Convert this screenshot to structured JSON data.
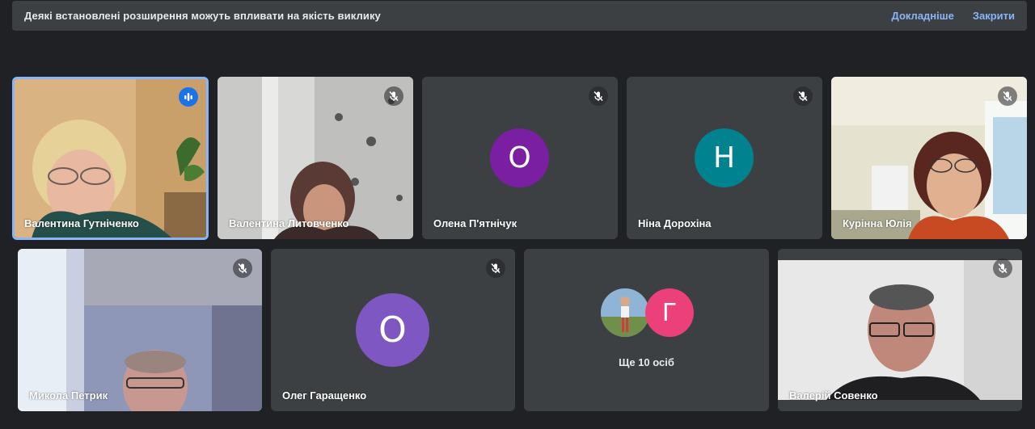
{
  "banner": {
    "message": "Деякі встановлені розширення можуть впливати на якість виклику",
    "details_link": "Докладніше",
    "close_link": "Закрити"
  },
  "participants": [
    {
      "name": "Валентина Гутніченко",
      "state": "speaking",
      "video": true
    },
    {
      "name": "Валентина Литовченко",
      "state": "muted",
      "video": true
    },
    {
      "name": "Олена П'ятнічук",
      "state": "muted",
      "video": false,
      "initial": "О",
      "avatar_color": "#7b1fa2"
    },
    {
      "name": "Ніна Дорохіна",
      "state": "muted",
      "video": false,
      "initial": "Н",
      "avatar_color": "#00838f"
    },
    {
      "name": "Курінна Юлія",
      "state": "muted",
      "video": true
    },
    {
      "name": "Микола Петрик",
      "state": "muted",
      "video": true
    },
    {
      "name": "Олег Гаращенко",
      "state": "muted",
      "video": false,
      "initial": "О",
      "avatar_color": "#7e57c2"
    },
    {
      "name": "Валерій Совенко",
      "state": "muted",
      "video": true
    }
  ],
  "overflow": {
    "label": "Ще 10 осіб",
    "avatar_initial": "Г",
    "avatar_color": "#ec407a"
  },
  "colors": {
    "background": "#202124",
    "tile": "#3c4043",
    "accent": "#8ab4f8",
    "speaking_indicator": "#1a73e8"
  },
  "icons": {
    "muted": "mic-off-icon",
    "speaking": "audio-level-icon"
  }
}
